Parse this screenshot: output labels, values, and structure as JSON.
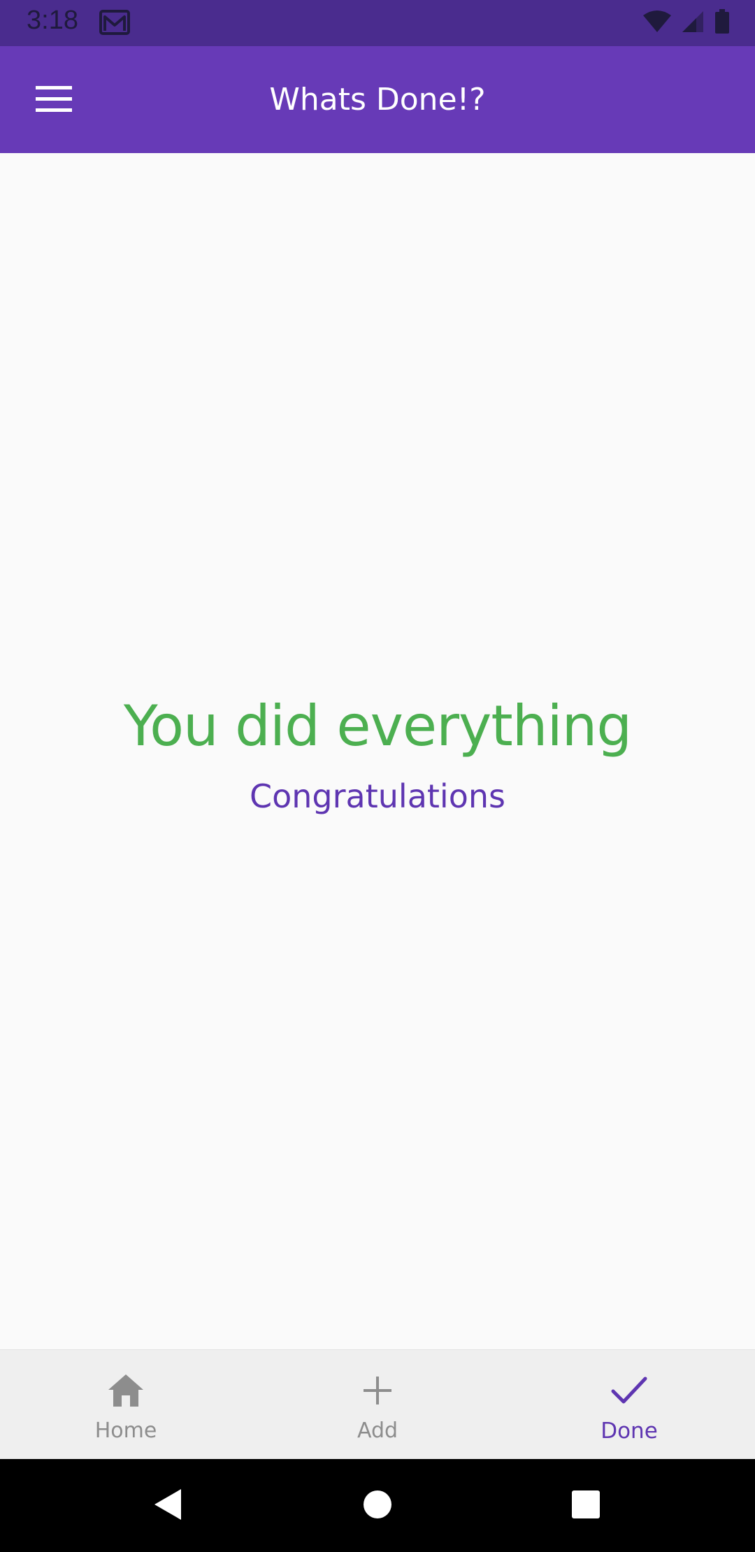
{
  "status_bar": {
    "time": "3:18",
    "icons": [
      "gmail-icon",
      "wifi-icon",
      "signal-icon",
      "battery-icon"
    ]
  },
  "app_bar": {
    "menu_icon": "hamburger-menu-icon",
    "title": "Whats Done!?"
  },
  "empty_state": {
    "headline": "You did everything",
    "subline": "Congratulations"
  },
  "bottom_nav": {
    "items": [
      {
        "label": "Home",
        "icon": "home-icon",
        "active": false
      },
      {
        "label": "Add",
        "icon": "plus-icon",
        "active": false
      },
      {
        "label": "Done",
        "icon": "check-icon",
        "active": true
      }
    ]
  },
  "system_nav": {
    "icons": [
      "back-icon",
      "home-circle-icon",
      "recents-icon"
    ]
  },
  "colors": {
    "status_bar": "#4a2c8e",
    "primary": "#673ab7",
    "accent": "#5e35b1",
    "success": "#4caf50",
    "nav_inactive": "#8d8d8d",
    "background": "#fafafa"
  }
}
